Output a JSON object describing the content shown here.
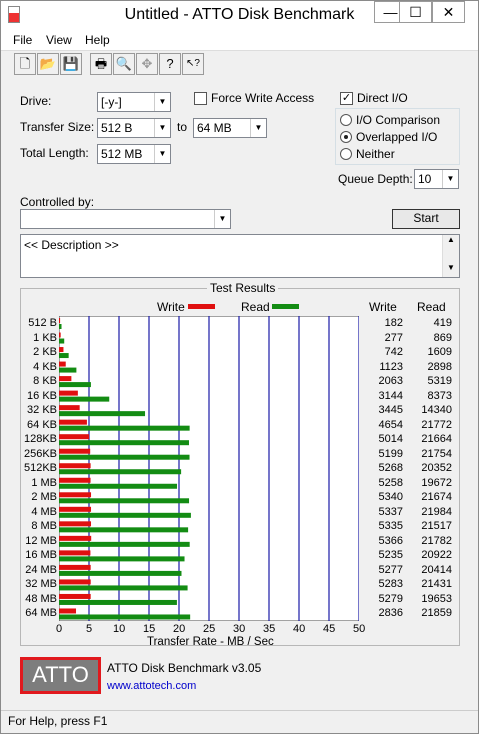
{
  "window": {
    "title": "Untitled - ATTO Disk Benchmark"
  },
  "controls": {
    "minimize": "—",
    "maximize": "☐",
    "close": "✕"
  },
  "menu": [
    "File",
    "View",
    "Help"
  ],
  "toolbar": [
    {
      "name": "new-icon",
      "glyph": "🗋"
    },
    {
      "name": "open-icon",
      "glyph": "📂"
    },
    {
      "name": "save-icon",
      "glyph": "💾"
    },
    {
      "name": "print-icon",
      "glyph": "🖶"
    },
    {
      "name": "print-preview-icon",
      "glyph": "🔍"
    },
    {
      "name": "move-icon",
      "glyph": "✥"
    },
    {
      "name": "help-icon",
      "glyph": "?"
    },
    {
      "name": "context-help-icon",
      "glyph": "↖?"
    }
  ],
  "settings": {
    "drive_label": "Drive:",
    "drive_value": "[-y-]",
    "transfer_size_label": "Transfer Size:",
    "transfer_from": "512 B",
    "to_label": "to",
    "transfer_to": "64 MB",
    "total_length_label": "Total Length:",
    "total_length": "512 MB",
    "force_write_label": "Force Write Access",
    "direct_io_label": "Direct I/O",
    "io_comparison_label": "I/O Comparison",
    "overlapped_io_label": "Overlapped I/O",
    "neither_label": "Neither",
    "queue_depth_label": "Queue Depth:",
    "queue_depth": "10",
    "controlled_by_label": "Controlled by:",
    "controlled_by_value": "",
    "start_label": "Start",
    "description": "<< Description >>"
  },
  "results": {
    "title": "Test Results",
    "legend_write": "Write",
    "legend_read": "Read",
    "col_write": "Write",
    "col_read": "Read",
    "axis_title": "Transfer Rate - MB / Sec"
  },
  "chart_data": {
    "type": "bar",
    "orientation": "horizontal",
    "categories": [
      "512 B",
      "1 KB",
      "2 KB",
      "4 KB",
      "8 KB",
      "16 KB",
      "32 KB",
      "64 KB",
      "128KB",
      "256KB",
      "512KB",
      "1 MB",
      "2 MB",
      "4 MB",
      "8 MB",
      "12 MB",
      "16 MB",
      "24 MB",
      "32 MB",
      "48 MB",
      "64 MB"
    ],
    "series": [
      {
        "name": "Write",
        "color": "#e01010",
        "values": [
          182,
          277,
          742,
          1123,
          2063,
          3144,
          3445,
          4654,
          5014,
          5199,
          5268,
          5258,
          5340,
          5337,
          5335,
          5366,
          5235,
          5277,
          5283,
          5279,
          2836
        ]
      },
      {
        "name": "Read",
        "color": "#138c13",
        "values": [
          419,
          869,
          1609,
          2898,
          5319,
          8373,
          14340,
          21772,
          21664,
          21754,
          20352,
          19672,
          21674,
          21984,
          21517,
          21782,
          20922,
          20414,
          21431,
          19653,
          21859
        ]
      }
    ],
    "bar_scale_mb_per_unit": 0.001,
    "xlim": [
      0,
      50
    ],
    "xticks": [
      0,
      5,
      10,
      15,
      20,
      25,
      30,
      35,
      40,
      45,
      50
    ],
    "xlabel": "Transfer Rate - MB / Sec"
  },
  "footer": {
    "logo_text": "ATTO",
    "product": "ATTO Disk Benchmark v3.05",
    "url": "www.attotech.com"
  },
  "status": "For Help, press F1"
}
